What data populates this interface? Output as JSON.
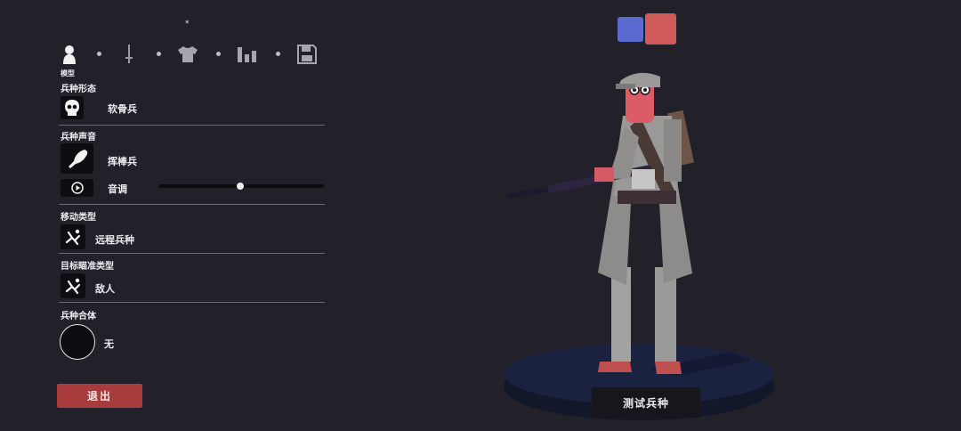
{
  "tabs": {
    "items": [
      {
        "icon": "person-icon"
      },
      {
        "icon": "sword-icon"
      },
      {
        "icon": "shirt-icon"
      },
      {
        "icon": "bar-chart-icon"
      },
      {
        "icon": "save-icon"
      }
    ],
    "active_label": "模型",
    "star": "*"
  },
  "sections": {
    "form": {
      "title": "兵种形态",
      "value": "软骨兵",
      "icon": "skull-icon"
    },
    "voice": {
      "title": "兵种声音",
      "value": "挥棒兵",
      "icon": "club-icon",
      "pitch_label": "音调",
      "pitch_level": 0.5
    },
    "movement": {
      "title": "移动类型",
      "value": "远程兵种",
      "icon": "running-figure-icon"
    },
    "targeting": {
      "title": "目标瞄准类型",
      "value": "敌人",
      "icon": "running-figure-icon"
    },
    "combine": {
      "title": "兵种合体",
      "value": "无"
    }
  },
  "buttons": {
    "exit": "退出",
    "test_unit": "测试兵种"
  },
  "team_colors": {
    "blue": "#5b6ad0",
    "red": "#d05a5a"
  }
}
